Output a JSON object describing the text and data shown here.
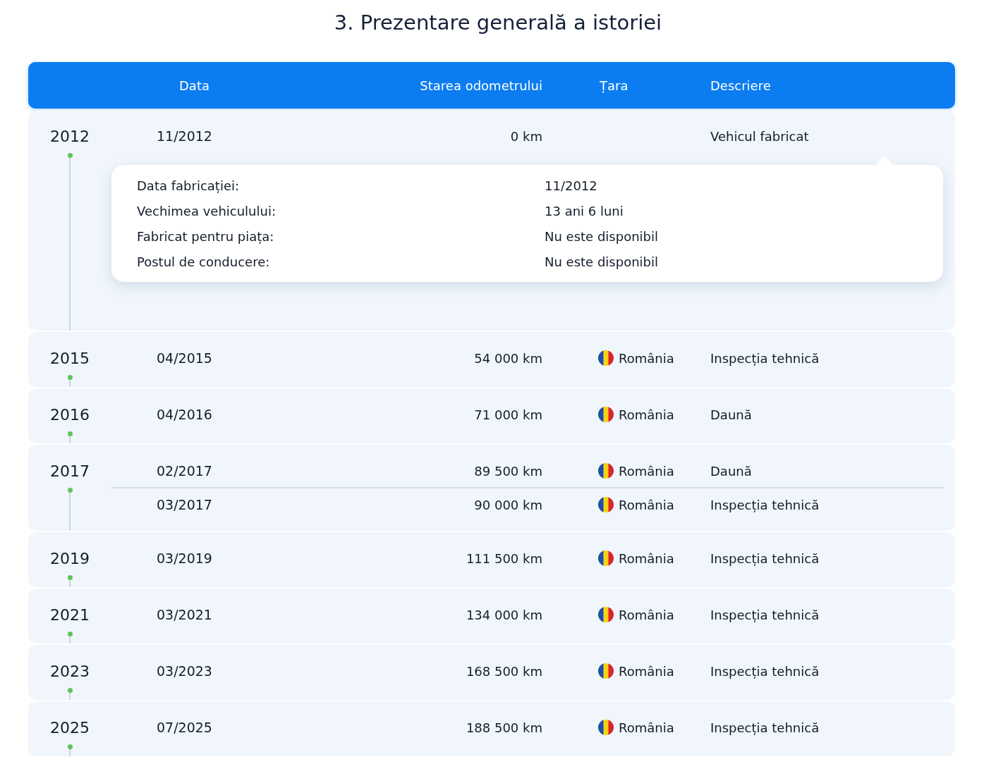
{
  "title": "3. Prezentare generală a istoriei",
  "columns": [
    "Data",
    "Starea odometrului",
    "Țara",
    "Descriere"
  ],
  "groups": [
    {
      "year": "2012",
      "entries": [
        {
          "date": "11/2012",
          "odometer": "0 km",
          "description": "Vehicul fabricat"
        }
      ],
      "details": [
        {
          "label": "Data fabricației:",
          "value": "11/2012"
        },
        {
          "label": "Vechimea vehiculului:",
          "value": "13 ani 6 luni"
        },
        {
          "label": "Fabricat pentru piața:",
          "value": "Nu este disponibil"
        },
        {
          "label": "Postul de conducere:",
          "value": "Nu este disponibil"
        }
      ]
    },
    {
      "year": "2015",
      "entries": [
        {
          "date": "04/2015",
          "odometer": "54 000 km",
          "country": "România",
          "description": "Inspecția tehnică"
        }
      ]
    },
    {
      "year": "2016",
      "entries": [
        {
          "date": "04/2016",
          "odometer": "71 000 km",
          "country": "România",
          "description": "Daună"
        }
      ]
    },
    {
      "year": "2017",
      "entries": [
        {
          "date": "02/2017",
          "odometer": "89 500 km",
          "country": "România",
          "description": "Daună"
        },
        {
          "date": "03/2017",
          "odometer": "90 000 km",
          "country": "România",
          "description": "Inspecția tehnică"
        }
      ]
    },
    {
      "year": "2019",
      "entries": [
        {
          "date": "03/2019",
          "odometer": "111 500 km",
          "country": "România",
          "description": "Inspecția tehnică"
        }
      ]
    },
    {
      "year": "2021",
      "entries": [
        {
          "date": "03/2021",
          "odometer": "134 000 km",
          "country": "România",
          "description": "Inspecția tehnică"
        }
      ]
    },
    {
      "year": "2023",
      "entries": [
        {
          "date": "03/2023",
          "odometer": "168 500 km",
          "country": "România",
          "description": "Inspecția tehnică"
        }
      ]
    },
    {
      "year": "2025",
      "entries": [
        {
          "date": "07/2025",
          "odometer": "188 500 km",
          "country": "România",
          "description": "Inspecția tehnică"
        }
      ]
    }
  ]
}
